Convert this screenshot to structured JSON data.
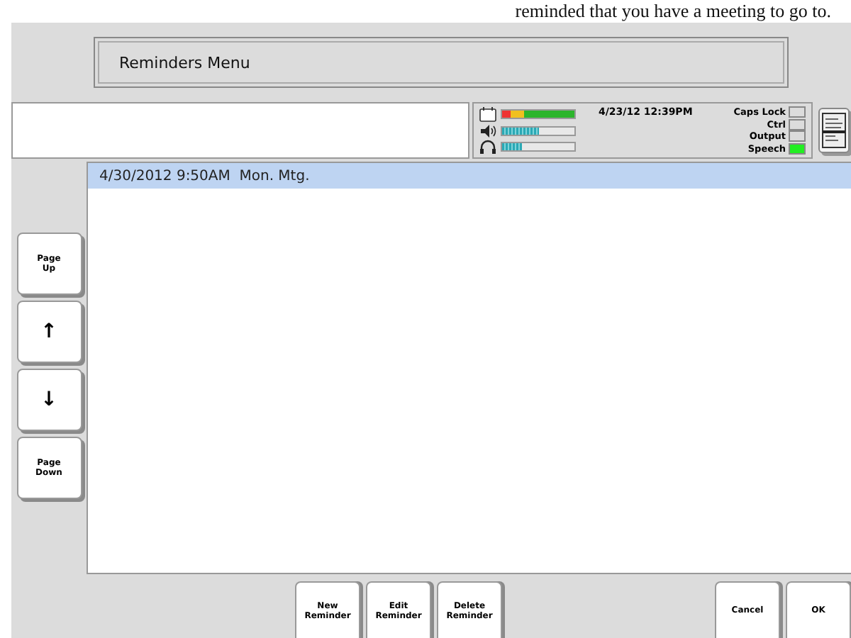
{
  "document_text": "reminded that you have a meeting to go to.",
  "title": "Reminders Menu",
  "status": {
    "meters": [
      {
        "kind": "battery",
        "level": 1.0
      },
      {
        "kind": "volume",
        "level": 0.5
      },
      {
        "kind": "headphones",
        "level": 0.27
      }
    ],
    "datetime": "4/23/12 12:39PM",
    "indicators": [
      {
        "label": "Caps Lock",
        "on": false
      },
      {
        "label": "Ctrl",
        "on": false
      },
      {
        "label": "Output",
        "on": false
      },
      {
        "label": "Speech",
        "on": true
      }
    ]
  },
  "side_buttons": [
    {
      "kind": "page",
      "label": "Page\nUp"
    },
    {
      "kind": "arrow",
      "label": "↑"
    },
    {
      "kind": "arrow",
      "label": "↓"
    },
    {
      "kind": "page",
      "label": "Page\nDown"
    }
  ],
  "reminders": [
    {
      "text": "4/30/2012 9:50AM  Mon. Mtg.",
      "selected": true
    }
  ],
  "bottom_buttons": [
    {
      "label": "New\nReminder"
    },
    {
      "label": "Edit\nReminder"
    },
    {
      "label": "Delete\nReminder"
    }
  ],
  "dialog_buttons": [
    {
      "label": "Cancel"
    },
    {
      "label": "OK"
    }
  ]
}
